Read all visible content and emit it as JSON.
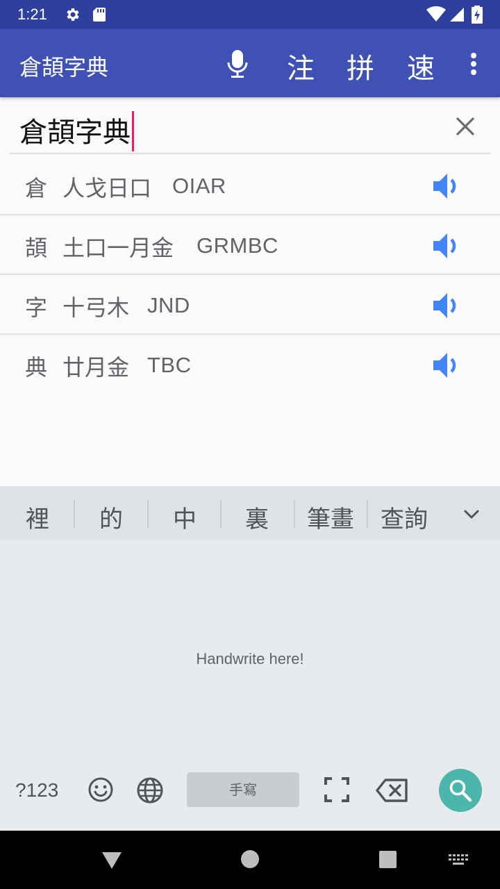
{
  "status_bar": {
    "time": "1:21",
    "icons": [
      "gear-icon",
      "sd-card-icon",
      "wifi-icon",
      "signal-icon",
      "battery-charging-icon"
    ]
  },
  "app_bar": {
    "title": "倉頡字典",
    "actions": {
      "zhuyin": "注",
      "pinyin": "拼",
      "quick": "速"
    },
    "colors": {
      "primary": "#3f51b5",
      "status": "#2f3f9e"
    }
  },
  "search": {
    "value": "倉頡字典"
  },
  "results": [
    {
      "char": "倉",
      "radicals": "人戈日口",
      "code": "OIAR"
    },
    {
      "char": "頡",
      "radicals": "土口一月金",
      "code": "GRMBC"
    },
    {
      "char": "字",
      "radicals": "十弓木",
      "code": "JND"
    },
    {
      "char": "典",
      "radicals": "廿月金",
      "code": "TBC"
    }
  ],
  "keyboard": {
    "suggestions": [
      "裡",
      "的",
      "中",
      "裏",
      "筆畫",
      "查詢"
    ],
    "handwrite_hint": "Handwrite here!",
    "symbols_key": "?123",
    "space_label": "手寫",
    "accent_color": "#4db6ac"
  }
}
